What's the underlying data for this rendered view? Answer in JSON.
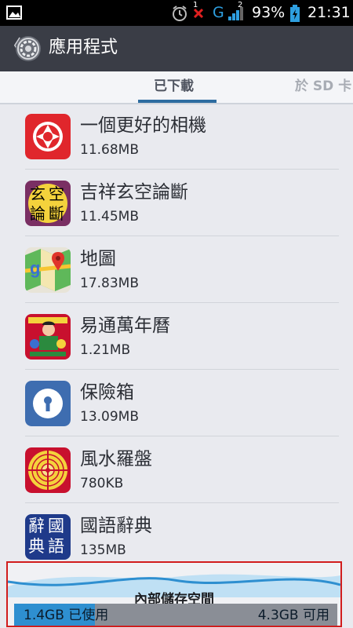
{
  "status_bar": {
    "network": "G",
    "sim_badge": "1",
    "signal_badge": "2",
    "battery_percent": "93%",
    "time": "21:31"
  },
  "action_bar": {
    "back_glyph": "〈",
    "title": "應用程式",
    "icon": "settings-gear-icon"
  },
  "tabs": [
    {
      "label": "已下載",
      "active": true
    },
    {
      "label": "於 SD 卡",
      "active": false
    }
  ],
  "apps": [
    {
      "name": "一個更好的相機",
      "size": "11.68MB",
      "icon": "camera-shutter-icon",
      "color": "#e0262c"
    },
    {
      "name": "吉祥玄空論斷",
      "size": "11.45MB",
      "icon": "text-tile-icon",
      "color": "#7a2f63",
      "icon_text": [
        "玄",
        "空",
        "論",
        "斷"
      ]
    },
    {
      "name": "地圖",
      "size": "17.83MB",
      "icon": "maps-icon",
      "color": "#4caf50"
    },
    {
      "name": "易通萬年曆",
      "size": "1.21MB",
      "icon": "calendar-boy-icon",
      "color": "#c8102e"
    },
    {
      "name": "保險箱",
      "size": "13.09MB",
      "icon": "safe-lock-icon",
      "color": "#3e6db0"
    },
    {
      "name": "風水羅盤",
      "size": "780KB",
      "icon": "compass-icon",
      "color": "#c8102e"
    },
    {
      "name": "國語辭典",
      "size": "135MB",
      "icon": "text-tile-icon",
      "color": "#1f3a8a",
      "icon_text": [
        "辭",
        "國",
        "典",
        "語"
      ]
    }
  ],
  "storage": {
    "label": "內部儲存空間",
    "used_label": "1.4GB 已使用",
    "free_label": "4.3GB 可用",
    "used_fraction": 0.25,
    "bar_color": "#2e8fd0",
    "highlight_color": "#d11d1d"
  }
}
